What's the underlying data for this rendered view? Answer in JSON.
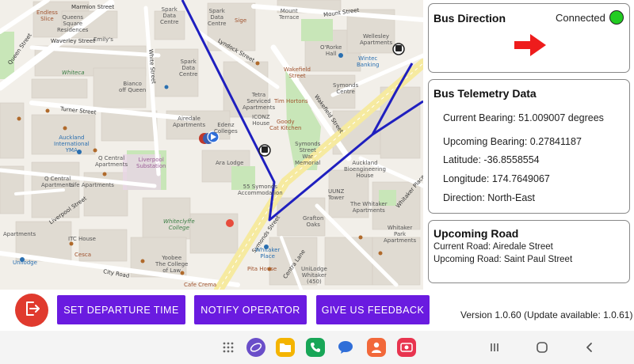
{
  "map": {
    "labels": {
      "marmion": "Marmion Street",
      "queens_square": "Queens\nSquare\nResidences",
      "endless": "Endless\nSlice",
      "waverley": "Waverley Street",
      "emily": "Emily's",
      "whitecat": "Whiteca",
      "queen_st": "Queen Street",
      "white_st": "White Street",
      "bianco": "Bianco\noff Queen",
      "spark1": "Spark\nData\nCentre",
      "spark2": "Spark\nData\nCentre",
      "spark3": "Spark\nData\nCentre",
      "sige": "Sige",
      "lyndock": "Lyndock Street",
      "mount": "Mount\nTerrace",
      "mount_st": "Mount Street",
      "wellesley": "Wellesley\nApartments",
      "ororke": "O'Rorke\nHall",
      "wintec": "Wintec\nBanking",
      "wakefield": "Wakefield\nStreet",
      "symonds_centre": "Symonds\nCentre",
      "tetra": "Tetra\nServiced\nApartments",
      "iconz": "ICONZ\nHouse",
      "tim": "Tim Hortons",
      "goody": "Goody\nCat Kitchen",
      "airedale_apts": "Airedale\nApartments",
      "edenz": "Edenz\nColleges",
      "ara": "Ara Lodge",
      "turner": "Turner Street",
      "auckland_intl": "Auckland\nInternational\nYMA",
      "wakefield_st": "Wakefield Street",
      "symonds_st_mem": "Symonds\nStreet\nWar\nMemorial",
      "auckland_bio": "Auckland\nBioengineering\nHouse",
      "airedale_st": "Airedale Street",
      "q_central": "Q Central\nApartments",
      "q_central2": "Q Central\nApartments",
      "life_apts": "Life Apartments",
      "liverpool": "Liverpool Street",
      "whitaker_pl": "Whitaker Place",
      "symonds_accom": "55 Symonds\nAccommodation",
      "uunz": "UUNZ\nTower",
      "whitaker_apts": "The Whitaker\nApartments",
      "grafton": "Grafton\nOaks",
      "whiteclyffe": "Whiteclyffe\nCollege",
      "symonds_st": "Symonds Street",
      "whitaker_park": "Whitaker\nPark\nApartments",
      "apartments": "Apartments",
      "itc": "ITC House",
      "city_road": "City Road",
      "yoobee": "Yoobee\nThe College\nof Law",
      "whitaker_place_lbl": "Whitaker\nPlace",
      "pita": "Pita House",
      "centra_lane": "Centra Lane",
      "unilodge": "UniLodge\nWhitaker\n(450)",
      "cafe_crema": "Cafe Crema",
      "ceca": "Cesca",
      "liverpool_station": "Liverpool\nSubstation",
      "unilodge_lbl": "Unilodge"
    }
  },
  "direction_card": {
    "title": "Bus Direction",
    "connection_label": "Connected",
    "connection_color": "#22cc22",
    "arrow_color": "#ee1c1c",
    "arrow_icon": "right-arrow-icon"
  },
  "telemetry_card": {
    "title": "Bus Telemetry Data",
    "current_bearing": "Current Bearing: 51.009007 degrees",
    "upcoming_bearing": "Upcoming Bearing: 0.27841187",
    "latitude": "Latitude: -36.8558554",
    "longitude": "Longitude: 174.7649067",
    "direction": "Direction: North-East"
  },
  "road_card": {
    "title": "Upcoming Road",
    "current_road": "Current Road: Airedale Street",
    "upcoming_road": "Upcoming Road: Saint Paul Street"
  },
  "actions": {
    "exit_icon": "exit-icon",
    "departure_label": "SET DEPARTURE TIME",
    "notify_label": "NOTIFY OPERATOR",
    "feedback_label": "GIVE US FEEDBACK",
    "button_color": "#6a1be0",
    "exit_color": "#e03a2e"
  },
  "version_text": "Version 1.0.60 (Update available: 1.0.61)",
  "navbar": {
    "dock": [
      "apps-grid-icon",
      "internet-icon",
      "files-icon",
      "phone-icon",
      "messages-icon",
      "contacts-icon",
      "screen-recorder-icon"
    ],
    "system": [
      "recents-icon",
      "home-icon",
      "back-icon"
    ]
  }
}
